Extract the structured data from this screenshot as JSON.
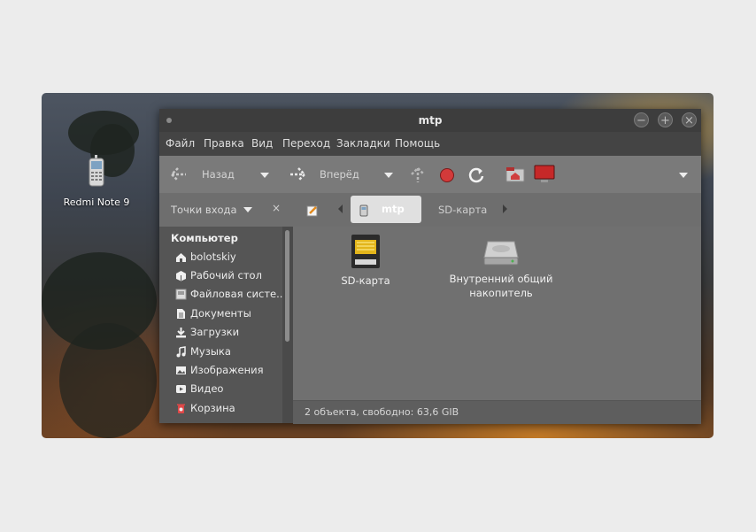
{
  "desktop": {
    "icon_label": "Redmi Note 9"
  },
  "window": {
    "title": "mtp"
  },
  "menubar": {
    "items": [
      "Файл",
      "Правка",
      "Вид",
      "Переход",
      "Закладки",
      "Помощь"
    ]
  },
  "toolbar": {
    "back_label": "Назад",
    "forward_label": "Вперёд"
  },
  "locationbar": {
    "places_label": "Точки входа",
    "crumbs": [
      "mtp",
      "SD-карта"
    ]
  },
  "sidebar": {
    "heading": "Компьютер",
    "items": [
      {
        "label": "bolotskiy",
        "icon": "home-icon"
      },
      {
        "label": "Рабочий стол",
        "icon": "desktop-icon"
      },
      {
        "label": "Файловая систе...",
        "icon": "filesystem-icon"
      },
      {
        "label": "Документы",
        "icon": "documents-icon"
      },
      {
        "label": "Загрузки",
        "icon": "downloads-icon"
      },
      {
        "label": "Музыка",
        "icon": "music-icon"
      },
      {
        "label": "Изображения",
        "icon": "pictures-icon"
      },
      {
        "label": "Видео",
        "icon": "videos-icon"
      },
      {
        "label": "Корзина",
        "icon": "trash-icon"
      }
    ]
  },
  "content": {
    "files": [
      {
        "name": "SD-карта",
        "icon": "sd-card-icon"
      },
      {
        "name_line1": "Внутренний общий",
        "name_line2": "накопитель",
        "icon": "internal-storage-icon"
      }
    ]
  },
  "status": {
    "text": "2 объекта, свободно: 63,6 GIB"
  },
  "colors": {
    "record_red": "#d33a3a",
    "window_bg": "#6d6d6d",
    "titlebar_bg": "#3d3d3d"
  }
}
